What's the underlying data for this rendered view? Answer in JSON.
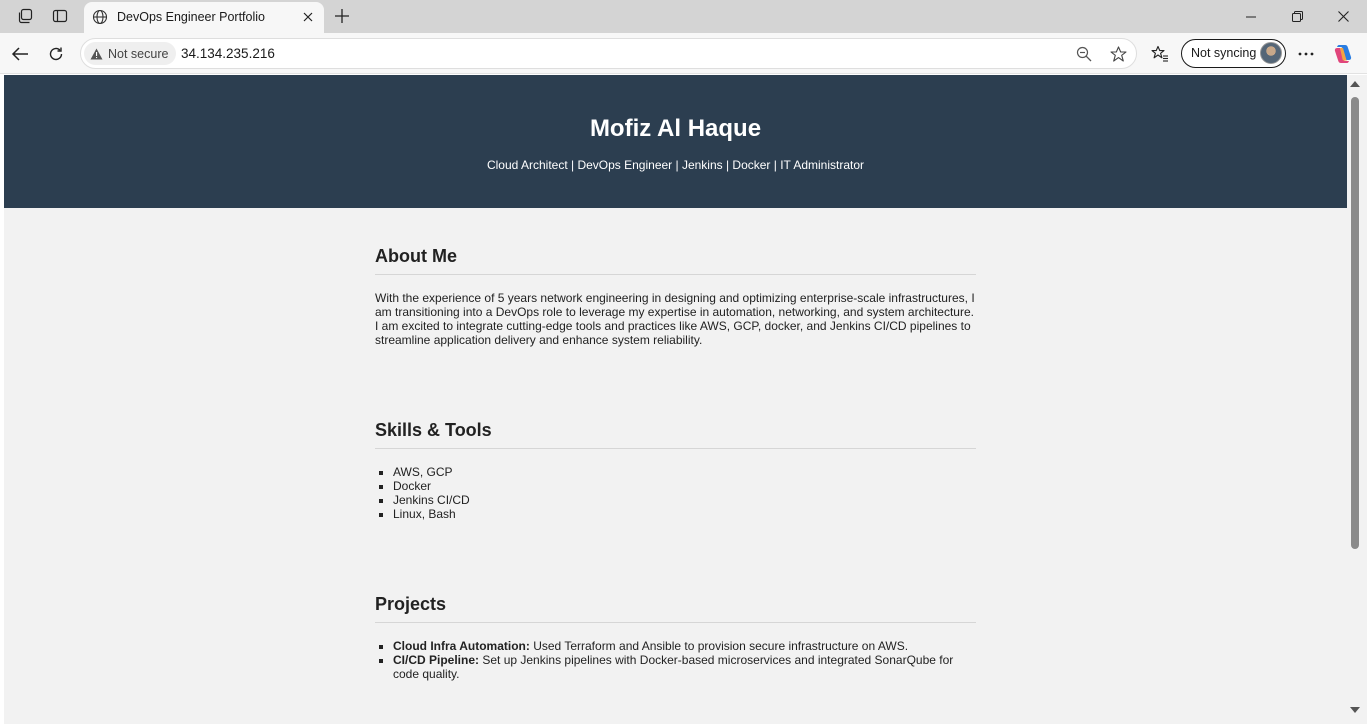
{
  "browser": {
    "tab": {
      "title": "DevOps Engineer Portfolio",
      "icon": "globe-icon"
    },
    "address": {
      "security_label": "Not secure",
      "url": "34.134.235.216"
    },
    "sync_label": "Not syncing"
  },
  "page": {
    "hero": {
      "name": "Mofiz Al Haque",
      "tagline": "Cloud Architect | DevOps Engineer | Jenkins | Docker | IT Administrator",
      "background": "#2c3e50"
    },
    "about": {
      "heading": "About Me",
      "text": "With the experience of 5 years network engineering in designing and optimizing enterprise-scale infrastructures, I am transitioning into a DevOps role to leverage my expertise in automation, networking, and system architecture. I am excited to integrate cutting-edge tools and practices like AWS, GCP, docker, and Jenkins CI/CD pipelines to streamline application delivery and enhance system reliability."
    },
    "skills": {
      "heading": "Skills & Tools",
      "items": [
        "AWS, GCP",
        "Docker",
        "Jenkins CI/CD",
        "Linux, Bash"
      ]
    },
    "projects": {
      "heading": "Projects",
      "items": [
        {
          "name": "Cloud Infra Automation:",
          "desc": " Used Terraform and Ansible to provision secure infrastructure on AWS."
        },
        {
          "name": "CI/CD Pipeline:",
          "desc": " Set up Jenkins pipelines with Docker-based microservices and integrated SonarQube for code quality."
        }
      ]
    }
  }
}
